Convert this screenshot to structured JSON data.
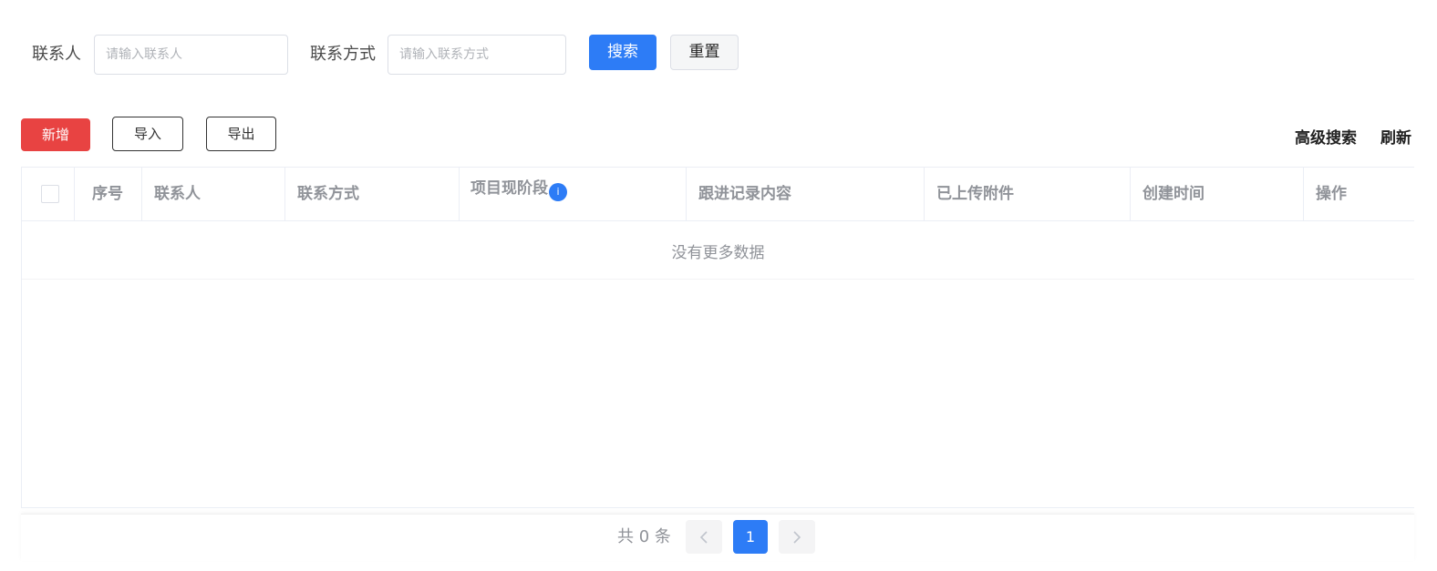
{
  "search": {
    "contact_label": "联系人",
    "contact_placeholder": "请输入联系人",
    "contact_value": "",
    "method_label": "联系方式",
    "method_placeholder": "请输入联系方式",
    "method_value": "",
    "search_label": "搜索",
    "reset_label": "重置"
  },
  "toolbar": {
    "add_label": "新增",
    "import_label": "导入",
    "export_label": "导出",
    "advanced_search_label": "高级搜索",
    "refresh_label": "刷新"
  },
  "table": {
    "columns": [
      "序号",
      "联系人",
      "联系方式",
      "项目现阶段",
      "跟进记录内容",
      "已上传附件",
      "创建时间",
      "操作"
    ],
    "info_icon": "info-icon",
    "rows": [],
    "empty_text": "没有更多数据"
  },
  "pagination": {
    "total_text": "共 0 条",
    "current_page": "1"
  },
  "colors": {
    "primary": "#2d7cf6",
    "danger": "#e84342"
  }
}
